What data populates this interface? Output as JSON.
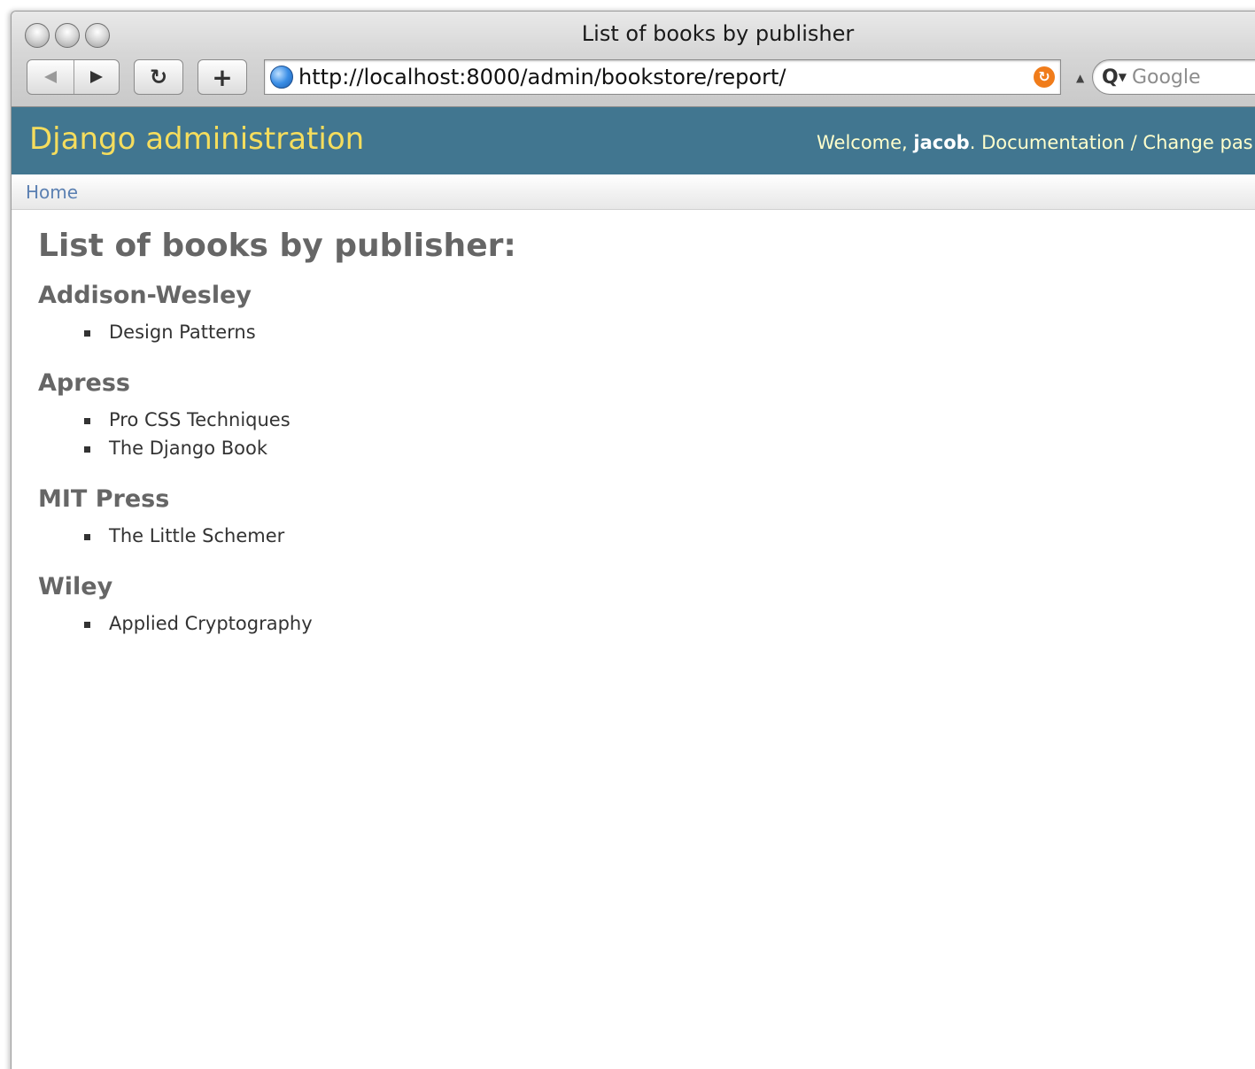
{
  "window": {
    "title": "List of books by publisher"
  },
  "toolbar": {
    "back_icon": "back-arrow-icon",
    "forward_icon": "forward-arrow-icon",
    "reload_icon": "reload-icon",
    "add_icon": "add-bookmark-icon",
    "reload_glyph": "↻",
    "add_glyph": "+",
    "url": "http://localhost:8000/admin/bookstore/report/",
    "search_placeholder": "Google"
  },
  "header": {
    "branding": "Django administration",
    "welcome": "Welcome,",
    "username": "jacob",
    "documentation": "Documentation",
    "separator": "/",
    "change_password": "Change pas"
  },
  "breadcrumbs": {
    "home": "Home"
  },
  "content": {
    "title": "List of books by publisher:",
    "publishers": [
      {
        "name": "Addison-Wesley",
        "books": [
          "Design Patterns"
        ]
      },
      {
        "name": "Apress",
        "books": [
          "Pro CSS Techniques",
          "The Django Book"
        ]
      },
      {
        "name": "MIT Press",
        "books": [
          "The Little Schemer"
        ]
      },
      {
        "name": "Wiley",
        "books": [
          "Applied Cryptography"
        ]
      }
    ]
  }
}
